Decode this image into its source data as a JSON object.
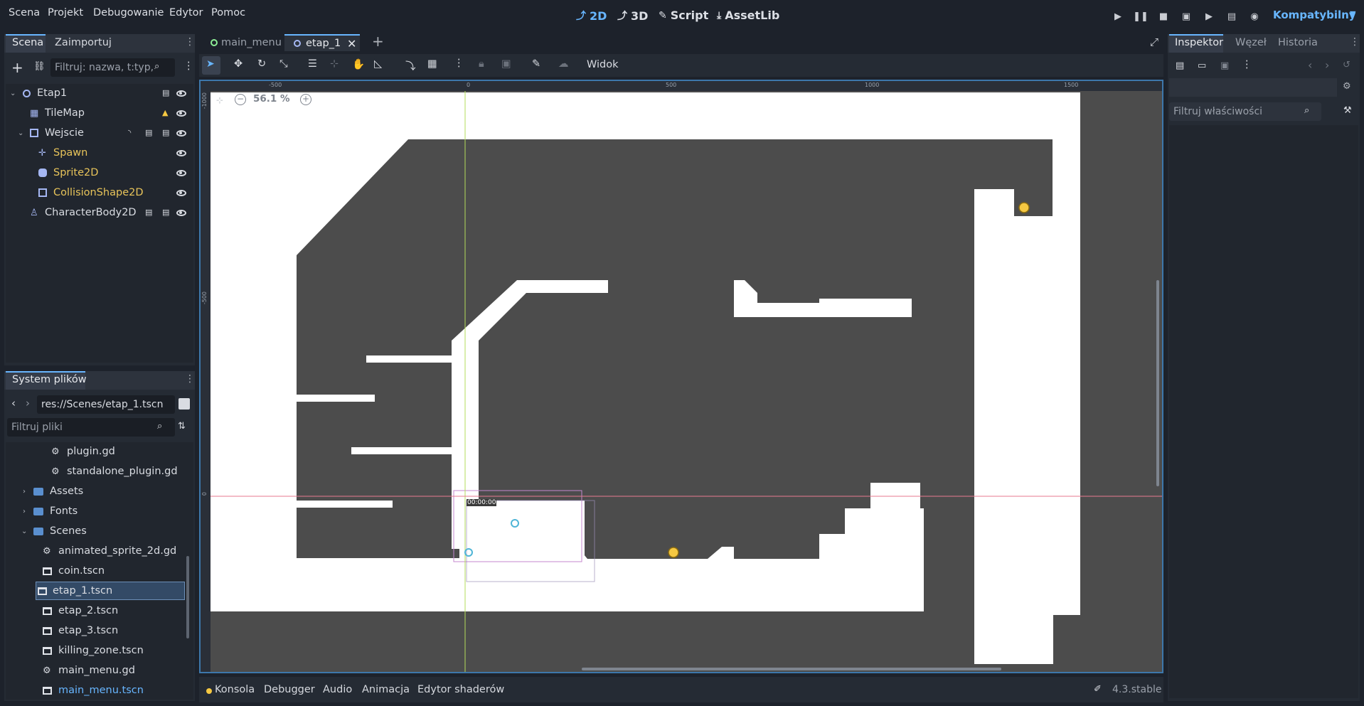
{
  "menubar": {
    "items": [
      "Scena",
      "Projekt",
      "Debugowanie",
      "Edytor",
      "Pomoc"
    ],
    "workspaces": [
      "2D",
      "3D",
      "Script",
      "AssetLib"
    ],
    "renderer": "Kompatybilny"
  },
  "scene_dock": {
    "tabs": [
      "Scena",
      "Zaimportuj"
    ],
    "filter_placeholder": "Filtruj: nazwa, t:typ,",
    "nodes": [
      {
        "label": "Etap1",
        "icon": "node2d-icon",
        "color": "#d9dce2"
      },
      {
        "label": "TileMap",
        "icon": "tilemap-icon",
        "color": "#d9dce2"
      },
      {
        "label": "Wejscie",
        "icon": "area2d-icon",
        "color": "#d9dce2"
      },
      {
        "label": "Spawn",
        "icon": "marker2d-icon",
        "color": "#e8c45a"
      },
      {
        "label": "Sprite2D",
        "icon": "sprite2d-icon",
        "color": "#e8c45a"
      },
      {
        "label": "CollisionShape2D",
        "icon": "collisionshape2d-icon",
        "color": "#e8c45a"
      },
      {
        "label": "CharacterBody2D",
        "icon": "characterbody2d-icon",
        "color": "#d9dce2"
      }
    ]
  },
  "filesystem": {
    "tab": "System plików",
    "path": "res://Scenes/etap_1.tscn",
    "filter_placeholder": "Filtruj pliki",
    "items": [
      {
        "label": "plugin.gd",
        "type": "script"
      },
      {
        "label": "standalone_plugin.gd",
        "type": "script"
      },
      {
        "label": "Assets",
        "type": "folder"
      },
      {
        "label": "Fonts",
        "type": "folder"
      },
      {
        "label": "Scenes",
        "type": "folder-open"
      },
      {
        "label": "animated_sprite_2d.gd",
        "type": "script"
      },
      {
        "label": "coin.tscn",
        "type": "scene"
      },
      {
        "label": "etap_1.tscn",
        "type": "scene",
        "selected": true
      },
      {
        "label": "etap_2.tscn",
        "type": "scene"
      },
      {
        "label": "etap_3.tscn",
        "type": "scene"
      },
      {
        "label": "killing_zone.tscn",
        "type": "scene"
      },
      {
        "label": "main_menu.gd",
        "type": "script"
      },
      {
        "label": "main_menu.tscn",
        "type": "scene",
        "highlight": true
      }
    ]
  },
  "editor_tabs": [
    {
      "label": "main_menu",
      "active": false
    },
    {
      "label": "etap_1",
      "active": true
    }
  ],
  "toolbar": {
    "view_label": "Widok"
  },
  "viewport": {
    "zoom": "56.1 %",
    "timestamp": "00:00:00",
    "ruler_h": [
      "-500",
      "0",
      "500",
      "1000",
      "1500"
    ],
    "ruler_v": [
      "-1000",
      "-500",
      "0"
    ]
  },
  "inspector": {
    "tabs": [
      "Inspektor",
      "Węzeł",
      "Historia"
    ],
    "filter_placeholder": "Filtruj właściwości"
  },
  "bottom_panel": {
    "tabs": [
      "Konsola",
      "Debugger",
      "Audio",
      "Animacja",
      "Edytor shaderów"
    ],
    "version": "4.3.stable"
  },
  "colors": {
    "accent": "#68b6ff",
    "warning": "#f5c842",
    "node_script_color": "#e8c45a",
    "selection": "#3d77ab"
  }
}
